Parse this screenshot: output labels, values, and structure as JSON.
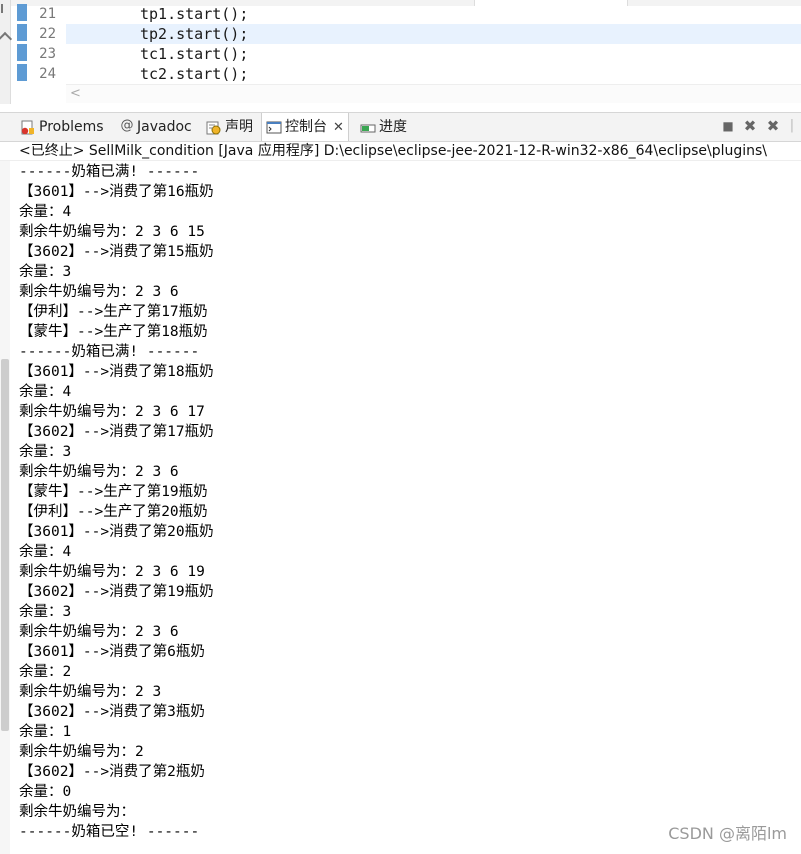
{
  "editor": {
    "lines": [
      {
        "num": "21",
        "code": "tp1.start();"
      },
      {
        "num": "22",
        "code": "tp2.start();"
      },
      {
        "num": "23",
        "code": "tc1.start();"
      },
      {
        "num": "24",
        "code": "tc2.start();"
      }
    ],
    "scroll_left": "<"
  },
  "views": {
    "tabs": [
      {
        "label": "Problems",
        "icon": "problems-icon"
      },
      {
        "label": "Javadoc",
        "icon": "at-icon"
      },
      {
        "label": "声明",
        "icon": "declaration-icon"
      },
      {
        "label": "控制台",
        "icon": "console-icon",
        "active": true
      },
      {
        "label": "进度",
        "icon": "progress-icon"
      }
    ],
    "close_glyph": "✕",
    "toolbar": {
      "stop": "■",
      "remove": "✖",
      "remove_all": "✖"
    }
  },
  "console": {
    "header": "<已终止> SellMilk_condition [Java 应用程序] D:\\eclipse\\eclipse-jee-2021-12-R-win32-x86_64\\eclipse\\plugins\\",
    "lines": [
      "------奶箱已满! ------",
      "【3601】-->消费了第16瓶奶",
      "余量：4",
      "剩余牛奶编号为：2 3 6 15",
      "【3602】-->消费了第15瓶奶",
      "余量：3",
      "剩余牛奶编号为：2 3 6",
      "【伊利】-->生产了第17瓶奶",
      "【蒙牛】-->生产了第18瓶奶",
      "------奶箱已满! ------",
      "【3601】-->消费了第18瓶奶",
      "余量：4",
      "剩余牛奶编号为：2 3 6 17",
      "【3602】-->消费了第17瓶奶",
      "余量：3",
      "剩余牛奶编号为：2 3 6",
      "【蒙牛】-->生产了第19瓶奶",
      "【伊利】-->生产了第20瓶奶",
      "【3601】-->消费了第20瓶奶",
      "余量：4",
      "剩余牛奶编号为：2 3 6 19",
      "【3602】-->消费了第19瓶奶",
      "余量：3",
      "剩余牛奶编号为：2 3 6",
      "【3601】-->消费了第6瓶奶",
      "余量：2",
      "剩余牛奶编号为：2 3",
      "【3602】-->消费了第3瓶奶",
      "余量：1",
      "剩余牛奶编号为：2",
      "【3602】-->消费了第2瓶奶",
      "余量：0",
      "剩余牛奶编号为：",
      "------奶箱已空! ------"
    ]
  },
  "watermark": "CSDN @离陌lm",
  "colors": {
    "line_marker": "#5e9bd4",
    "current_line": "#e8f2fe",
    "tab_bg": "#f3f3f3"
  }
}
